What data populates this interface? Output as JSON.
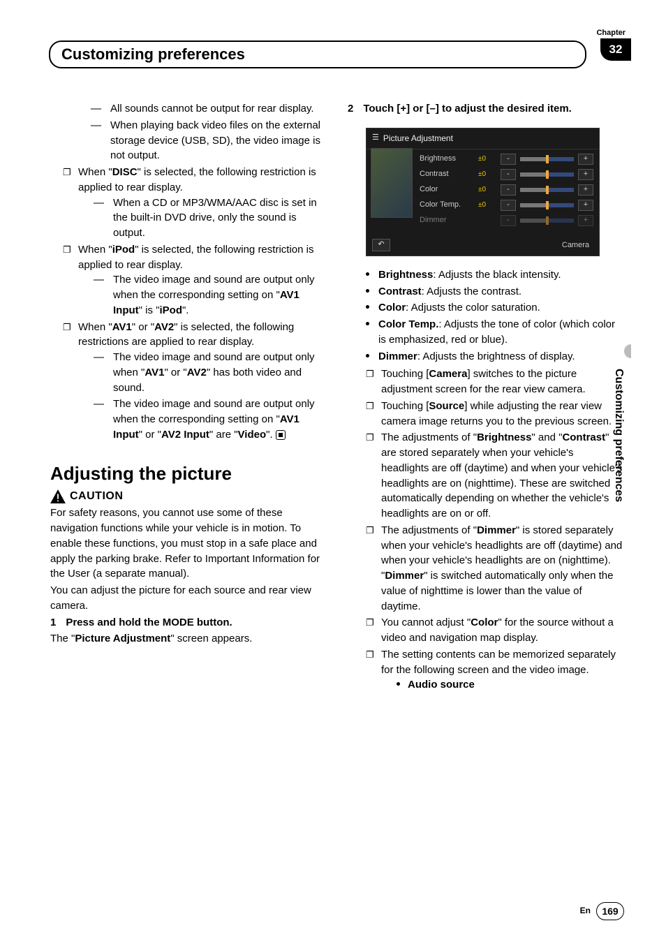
{
  "header": {
    "chapter_label": "Chapter",
    "chapter_num": "32",
    "title": "Customizing preferences"
  },
  "side_tab": "Customizing preferences",
  "footer": {
    "lang": "En",
    "page": "169"
  },
  "left": {
    "dash1": [
      "All sounds cannot be output for rear display.",
      "When playing back video files on the external storage device (USB, SD), the video image is not output."
    ],
    "box_items": [
      {
        "lead": "When \"",
        "b1": "DISC",
        "tail": "\" is selected, the following restriction is applied to rear display.",
        "dashes": [
          "When a CD or MP3/WMA/AAC disc is set in the built-in DVD drive, only the sound is output."
        ]
      },
      {
        "lead": "When \"",
        "b1": "iPod",
        "tail": "\" is selected, the following restriction is applied to rear display.",
        "dashes_html": [
          {
            "pre": "The video image and sound are output only when the corresponding setting on \"",
            "b1": "AV1 Input",
            "mid": "\" is \"",
            "b2": "iPod",
            "post": "\"."
          }
        ]
      },
      {
        "lead": "When \"",
        "b1": "AV1",
        "mid": "\" or \"",
        "b2": "AV2",
        "tail": "\" is selected, the following restrictions are applied to rear display.",
        "dashes_html": [
          {
            "pre": "The video image and sound are output only when \"",
            "b1": "AV1",
            "mid": "\" or \"",
            "b2": "AV2",
            "post": "\" has both video and sound."
          },
          {
            "pre": "The video image and sound are output only when the corresponding setting on \"",
            "b1": "AV1 Input",
            "mid": "\" or \"",
            "b2": "AV2 Input",
            "post2": "\" are \"",
            "b3": "Video",
            "post": "\"."
          }
        ]
      }
    ],
    "section_heading": "Adjusting the picture",
    "caution": "CAUTION",
    "caution_para": "For safety reasons, you cannot use some of these navigation functions while your vehicle is in motion. To enable these functions, you must stop in a safe place and apply the parking brake. Refer to Important Information for the User (a separate manual).",
    "intro_para": "You can adjust the picture for each source and rear view camera.",
    "step1_num": "1",
    "step1": "Press and hold the MODE button.",
    "step1_after_pre": "The \"",
    "step1_after_b": "Picture Adjustment",
    "step1_after_post": "\" screen appears."
  },
  "right": {
    "step2_num": "2",
    "step2": "Touch [+] or [–] to adjust the desired item.",
    "screenshot": {
      "title": "Picture Adjustment",
      "rows": [
        {
          "label": "Brightness",
          "val": "±0"
        },
        {
          "label": "Contrast",
          "val": "±0"
        },
        {
          "label": "Color",
          "val": "±0"
        },
        {
          "label": "Color Temp.",
          "val": "±0"
        },
        {
          "label": "Dimmer",
          "val": ""
        }
      ],
      "camera": "Camera"
    },
    "bullets": [
      {
        "b": "Brightness",
        "t": ": Adjusts the black intensity."
      },
      {
        "b": "Contrast",
        "t": ": Adjusts the contrast."
      },
      {
        "b": "Color",
        "t": ": Adjusts the color saturation."
      },
      {
        "b": "Color Temp.",
        "t": ": Adjusts the tone of color (which color is emphasized, red or blue)."
      },
      {
        "b": "Dimmer",
        "t": ": Adjusts the brightness of display."
      }
    ],
    "boxes": [
      {
        "pre": "Touching [",
        "b1": "Camera",
        "post": "] switches to the picture adjustment screen for the rear view camera."
      },
      {
        "pre": "Touching [",
        "b1": "Source",
        "post": "] while adjusting the rear view camera image returns you to the previous screen."
      },
      {
        "pre": "The adjustments of \"",
        "b1": "Brightness",
        "mid": "\" and \"",
        "b2": "Contrast",
        "post": "\" are stored separately when your vehicle's headlights are off (daytime) and when your vehicle's headlights are on (nighttime). These are switched automatically depending on whether the vehicle's headlights are on or off."
      },
      {
        "pre": "The adjustments of \"",
        "b1": "Dimmer",
        "mid2": "\" is stored separately when your vehicle's headlights are off (daytime) and when your vehicle's headlights are on (nighttime). \"",
        "b2": "Dimmer",
        "post": "\" is switched automatically only when the value of nighttime is lower than the value of daytime."
      },
      {
        "pre": "You cannot adjust \"",
        "b1": "Color",
        "post": "\" for the source without a video and navigation map display."
      },
      {
        "pre": "The setting contents can be memorized separately for the following screen and the video image.",
        "nested": "Audio source"
      }
    ]
  }
}
